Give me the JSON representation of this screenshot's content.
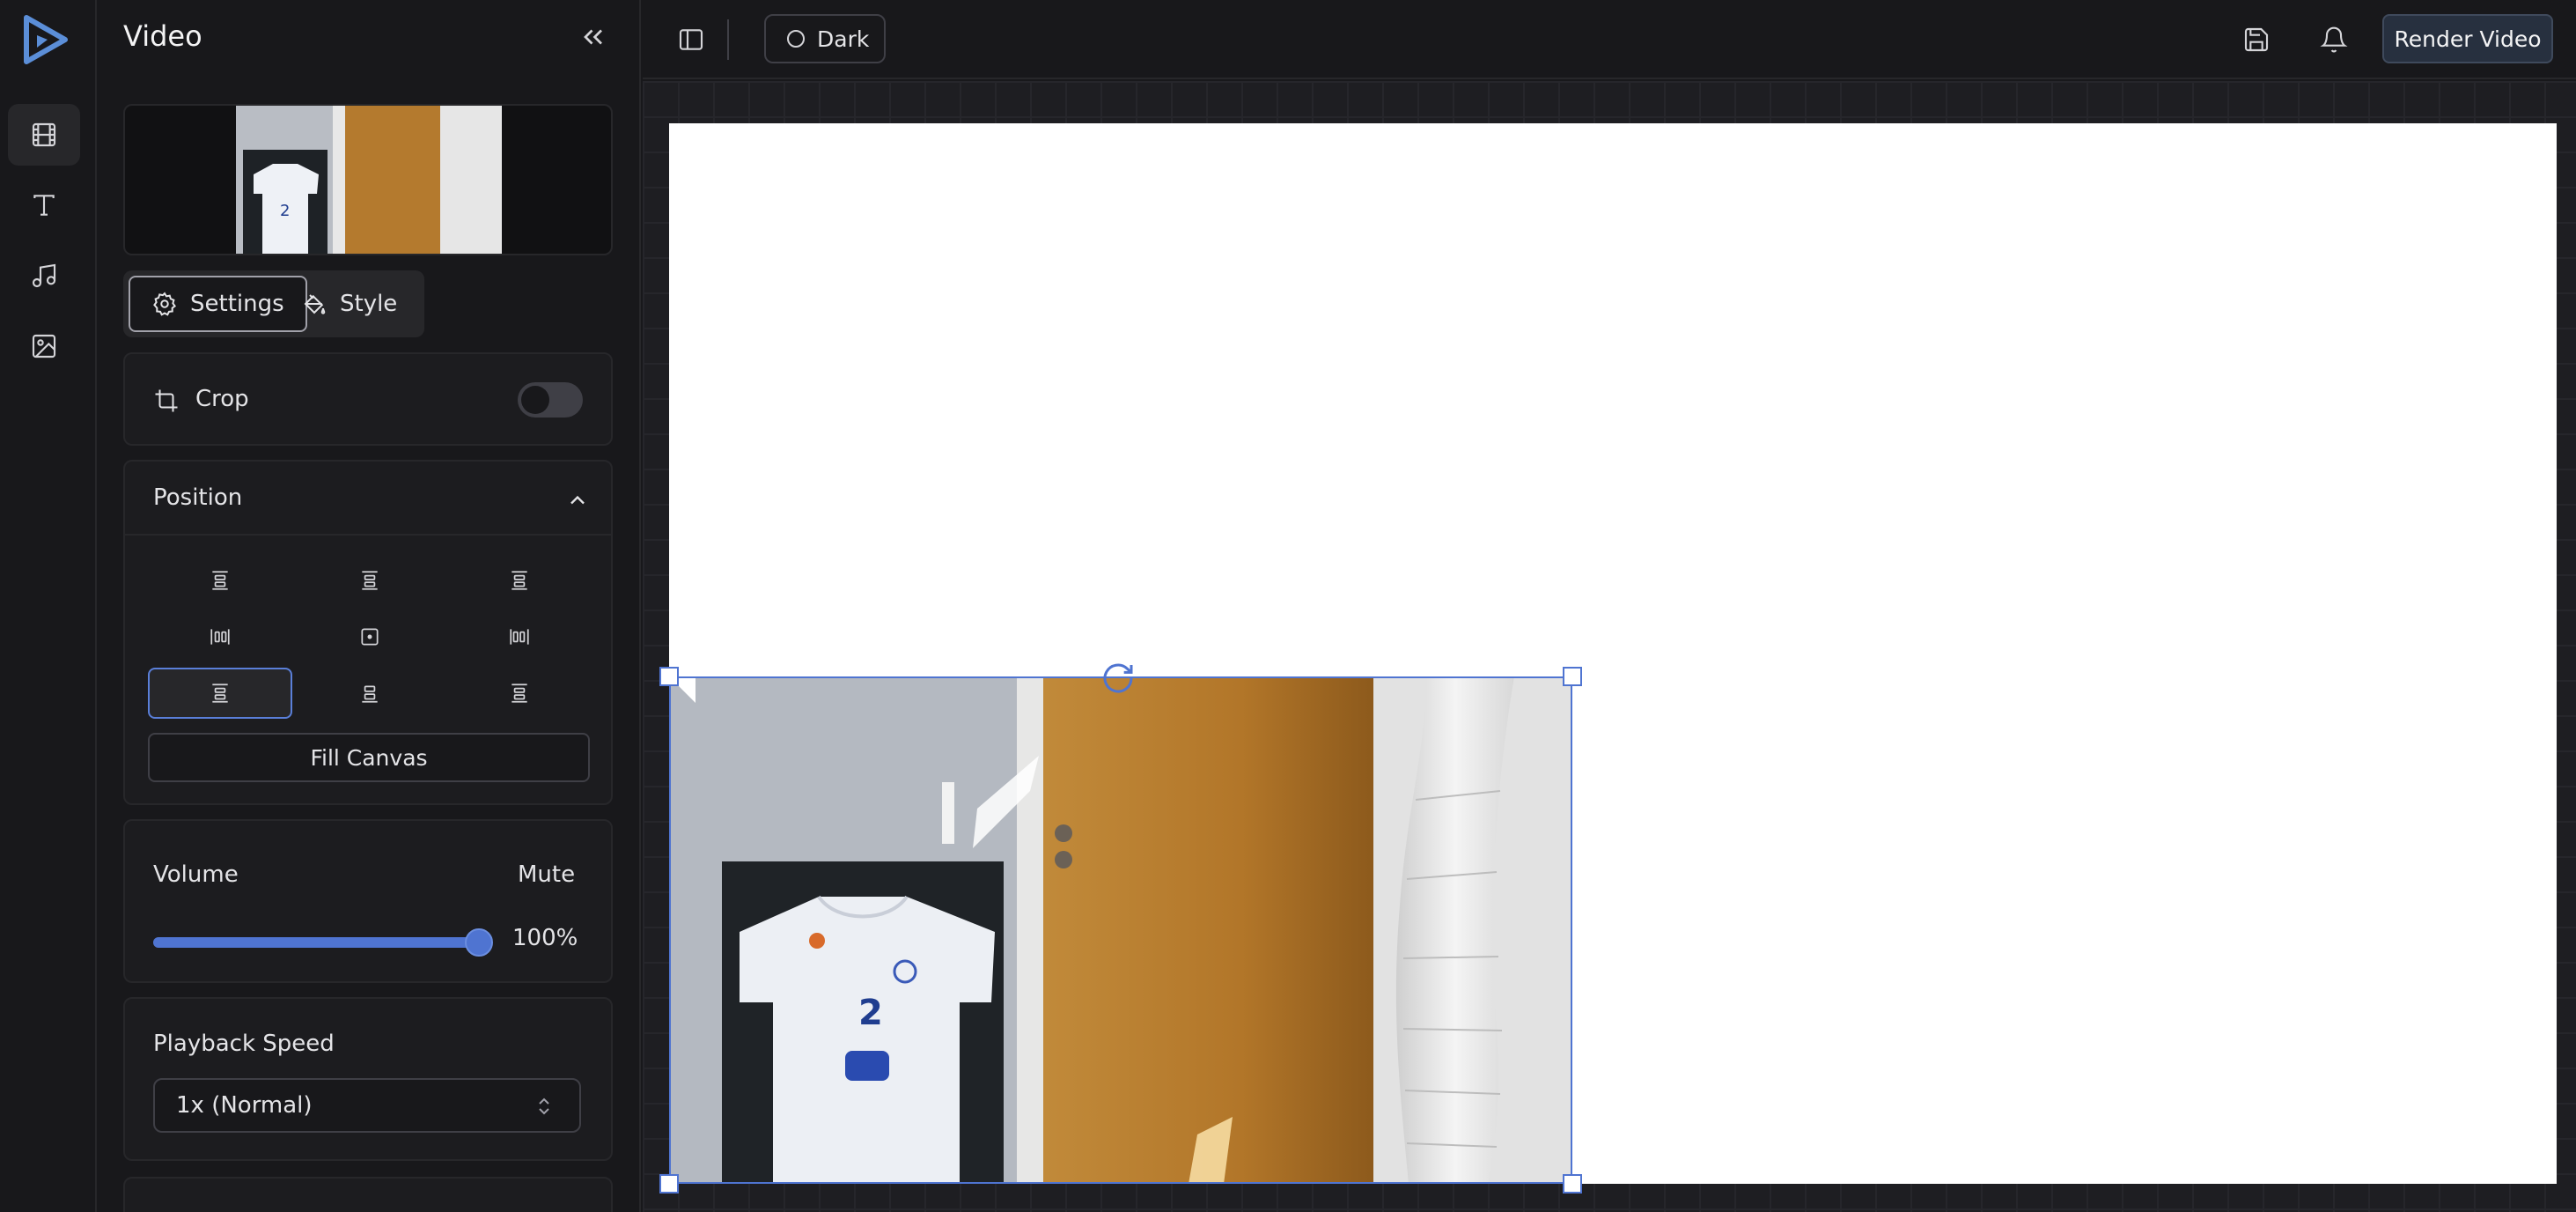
{
  "sidebar": {
    "title": "Video",
    "rail_items": [
      {
        "icon": "film-icon",
        "active": true
      },
      {
        "icon": "text-icon",
        "active": false
      },
      {
        "icon": "music-icon",
        "active": false
      },
      {
        "icon": "image-icon",
        "active": false
      }
    ],
    "tabs": [
      {
        "label": "Settings",
        "icon": "gear-icon",
        "active": true
      },
      {
        "label": "Style",
        "icon": "paint-bucket-icon",
        "active": false
      }
    ],
    "crop": {
      "label": "Crop",
      "enabled": false
    },
    "position": {
      "label": "Position",
      "fill_canvas_label": "Fill Canvas",
      "selected": "top-left"
    },
    "volume": {
      "label": "Volume",
      "mute_label": "Mute",
      "value_text": "100%",
      "value": 100
    },
    "playback_speed": {
      "label": "Playback Speed",
      "selected": "1x (Normal)"
    }
  },
  "topbar": {
    "theme_label": "Dark",
    "render_label": "Render Video"
  },
  "colors": {
    "accent": "#4f74d1",
    "background": "#18181b",
    "canvas": "#ffffff"
  }
}
